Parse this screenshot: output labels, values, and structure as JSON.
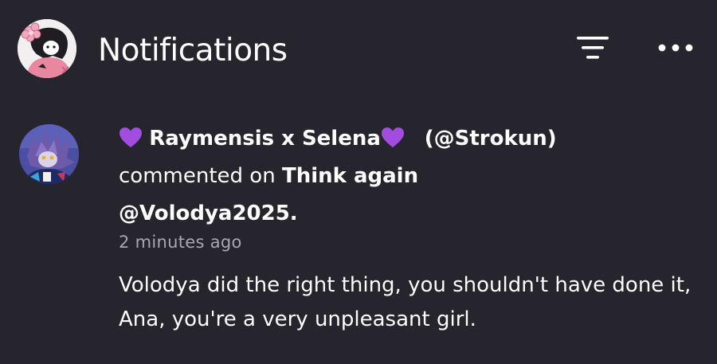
{
  "header": {
    "title": "Notifications",
    "icons": {
      "avatar": "user-avatar",
      "filter": "filter-icon",
      "more": "more-options-icon"
    }
  },
  "notification": {
    "display_name": "Raymensis x Selena",
    "handle": "(@Strokun)",
    "action": "commented on",
    "post_title": "Think again",
    "post_author": "@Volodya2025.",
    "time": "2 minutes ago",
    "comment": "Volodya did the right thing, you shouldn't have done it, Ana, you're a very unpleasant girl.",
    "icons": {
      "avatar": "commenter-avatar",
      "heart": "purple-heart-icon"
    }
  },
  "colors": {
    "background": "#26242c",
    "text": "#ffffff",
    "muted_text": "#a9a7b0",
    "heart": "#a24de0"
  }
}
